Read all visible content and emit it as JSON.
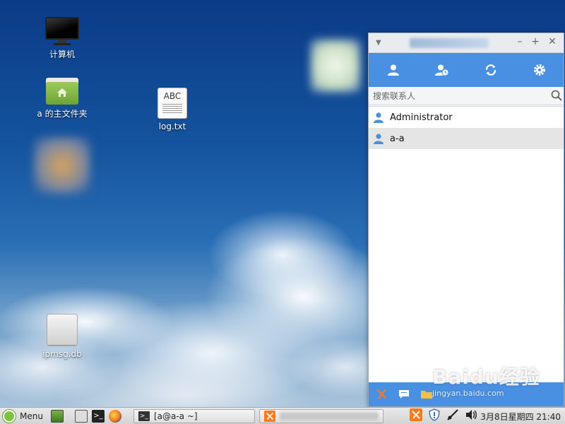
{
  "desktop": {
    "icons": [
      {
        "label": "计算机"
      },
      {
        "label": "a 的主文件夹"
      },
      {
        "label": "log.txt",
        "file_glyph": "ABC"
      },
      {
        "label": "ipmsg.db"
      }
    ]
  },
  "messenger": {
    "search_placeholder": "搜索联系人",
    "contacts": [
      {
        "name": "Administrator",
        "selected": false
      },
      {
        "name": "a-a",
        "selected": true
      }
    ],
    "toolbar_icons": [
      "contacts-icon",
      "recent-contacts-icon",
      "refresh-icon",
      "settings-icon"
    ],
    "bottom_icons": [
      "tools-icon",
      "message-icon",
      "folder-icon"
    ],
    "accent_color": "#4a90e2"
  },
  "taskbar": {
    "menu_label": "Menu",
    "terminal_task": "[a@a-a ~]",
    "clock": "3月8日星期四 21:40"
  },
  "watermark": {
    "text": "Baidu经验",
    "sub": "jingyan.baidu.com"
  }
}
